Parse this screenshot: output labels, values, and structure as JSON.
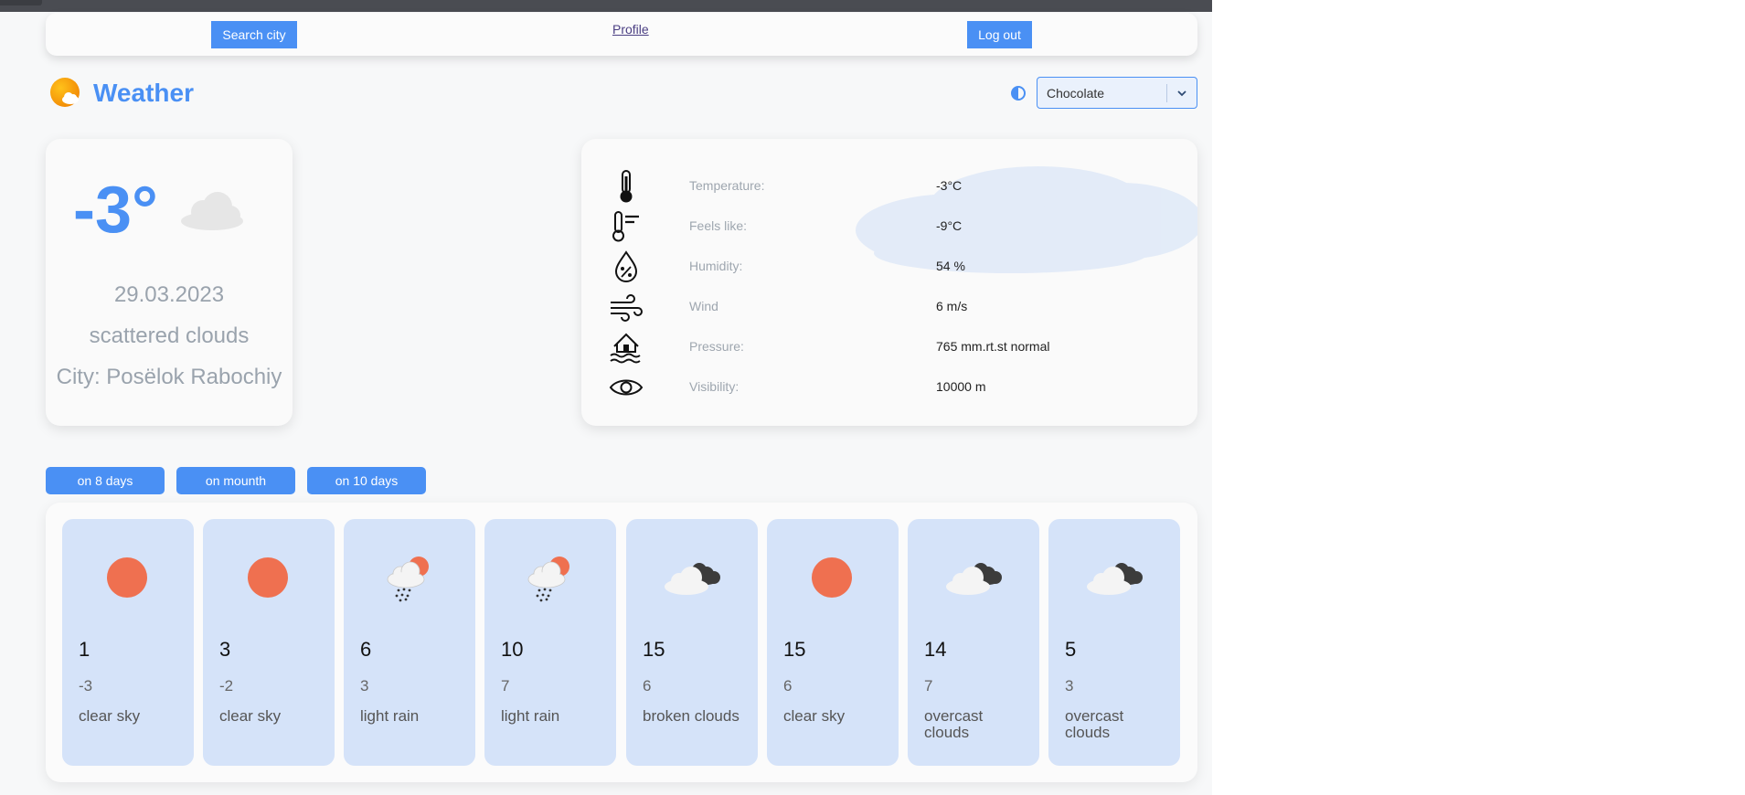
{
  "nav": {
    "search_label": "Search city",
    "profile_label": "Profile",
    "logout_label": "Log out"
  },
  "header": {
    "title": "Weather",
    "theme_select": {
      "value": "Chocolate"
    }
  },
  "current": {
    "temperature": "-3°",
    "date": "29.03.2023",
    "description": "scattered clouds",
    "city": "City: Posëlok Rabochiy"
  },
  "details": {
    "rows": [
      {
        "icon": "thermometer-icon",
        "label": "Temperature:",
        "value": "-3°C"
      },
      {
        "icon": "feels-like-icon",
        "label": "Feels like:",
        "value": "-9°C"
      },
      {
        "icon": "humidity-icon",
        "label": "Humidity:",
        "value": "54 %"
      },
      {
        "icon": "wind-icon",
        "label": "Wind",
        "value": "6 m/s"
      },
      {
        "icon": "pressure-icon",
        "label": "Pressure:",
        "value": "765 mm.rt.st normal"
      },
      {
        "icon": "visibility-icon",
        "label": "Visibility:",
        "value": "10000 m"
      }
    ]
  },
  "tabs": [
    {
      "label": "on 8 days"
    },
    {
      "label": "on mounth"
    },
    {
      "label": "on 10 days"
    }
  ],
  "forecast": [
    {
      "icon": "sun-icon",
      "day": "1",
      "temp": "-3",
      "desc": "clear sky"
    },
    {
      "icon": "sun-icon",
      "day": "3",
      "temp": "-2",
      "desc": "clear sky"
    },
    {
      "icon": "rain-icon",
      "day": "6",
      "temp": "3",
      "desc": "light rain"
    },
    {
      "icon": "rain-icon",
      "day": "10",
      "temp": "7",
      "desc": "light rain"
    },
    {
      "icon": "broken-clouds-icon",
      "day": "15",
      "temp": "6",
      "desc": "broken clouds"
    },
    {
      "icon": "sun-icon",
      "day": "15",
      "temp": "6",
      "desc": "clear sky"
    },
    {
      "icon": "overcast-clouds-icon",
      "day": "14",
      "temp": "7",
      "desc": "overcast clouds"
    },
    {
      "icon": "overcast-clouds-icon",
      "day": "5",
      "temp": "3",
      "desc": "overcast clouds"
    }
  ],
  "colors": {
    "accent": "#4a90f4",
    "sun": "#ef7050",
    "card_day": "#d5e3f9"
  }
}
